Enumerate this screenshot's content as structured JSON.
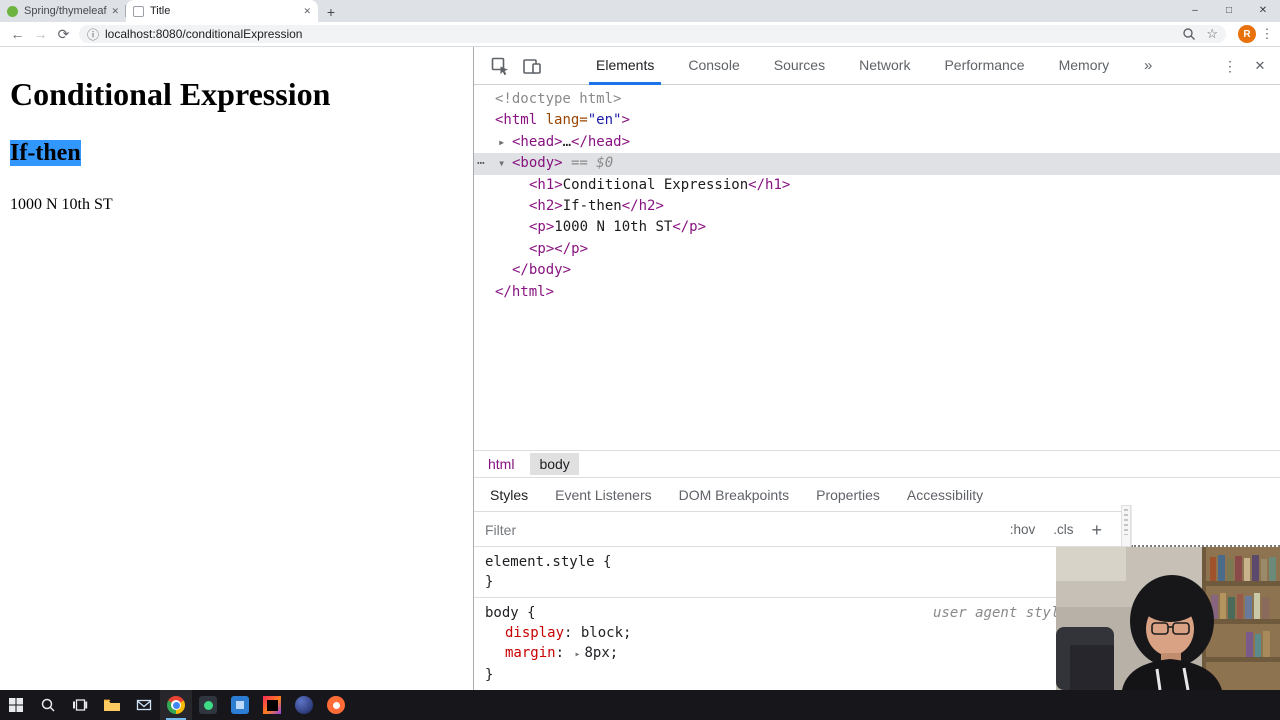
{
  "browser": {
    "tabs": [
      {
        "label": "Spring/thymeleafexpressionsynt",
        "active": false
      },
      {
        "label": "Title",
        "active": true
      }
    ],
    "url": "localhost:8080/conditionalExpression",
    "profile_initial": "R"
  },
  "icons": {
    "back": "←",
    "forward": "→",
    "reload": "⟳",
    "page_info": "ⓘ",
    "bookmark_star": "☆",
    "kebab_menu": "⋮",
    "window_minimize": "–",
    "window_maximize": "□",
    "window_close": "✕",
    "tab_close": "✕",
    "new_tab": "+",
    "devtools_overflow": "»",
    "devtools_close": "✕",
    "expand": "▸",
    "collapse": "▾",
    "more": "⋯"
  },
  "page": {
    "heading": "Conditional Expression",
    "subheading": "If-then",
    "paragraph": "1000 N 10th ST"
  },
  "devtools": {
    "tabs": [
      "Elements",
      "Console",
      "Sources",
      "Network",
      "Performance",
      "Memory"
    ],
    "active_tab": "Elements",
    "dom_tree": [
      {
        "name": "doctype",
        "indent": 0,
        "tokens": [
          {
            "t": "grey",
            "v": "<!doctype html>"
          }
        ]
      },
      {
        "name": "html-open",
        "indent": 0,
        "tokens": [
          {
            "t": "tag",
            "v": "<html"
          },
          {
            "t": "attr",
            "v": " lang="
          },
          {
            "t": "val",
            "v": "\"en\""
          },
          {
            "t": "tag",
            "v": ">"
          }
        ]
      },
      {
        "name": "head",
        "indent": 1,
        "arrow": "collapsed",
        "tokens": [
          {
            "t": "tag",
            "v": "<head>"
          },
          {
            "t": "text",
            "v": "…"
          },
          {
            "t": "tag",
            "v": "</head>"
          }
        ]
      },
      {
        "name": "body",
        "indent": 1,
        "arrow": "expanded",
        "selected": true,
        "ellipsis": true,
        "tokens": [
          {
            "t": "tag",
            "v": "<body>"
          },
          {
            "t": "grey",
            "v": " == "
          },
          {
            "t": "ital",
            "v": "$0"
          }
        ]
      },
      {
        "name": "h1",
        "indent": 2,
        "tokens": [
          {
            "t": "tag",
            "v": "<h1>"
          },
          {
            "t": "text",
            "v": "Conditional Expression"
          },
          {
            "t": "tag",
            "v": "</h1>"
          }
        ]
      },
      {
        "name": "h2",
        "indent": 2,
        "tokens": [
          {
            "t": "tag",
            "v": "<h2>"
          },
          {
            "t": "text",
            "v": "If-then"
          },
          {
            "t": "tag",
            "v": "</h2>"
          }
        ]
      },
      {
        "name": "p",
        "indent": 2,
        "tokens": [
          {
            "t": "tag",
            "v": "<p>"
          },
          {
            "t": "text",
            "v": "1000 N 10th ST"
          },
          {
            "t": "tag",
            "v": "</p>"
          }
        ]
      },
      {
        "name": "p-empty",
        "indent": 2,
        "tokens": [
          {
            "t": "tag",
            "v": "<p>"
          },
          {
            "t": "tag",
            "v": "</p>"
          }
        ]
      },
      {
        "name": "body-close",
        "indent": 1,
        "tokens": [
          {
            "t": "tag",
            "v": "</body>"
          }
        ]
      },
      {
        "name": "html-close",
        "indent": 0,
        "tokens": [
          {
            "t": "tag",
            "v": "</html>"
          }
        ]
      }
    ],
    "breadcrumbs": [
      {
        "label": "html",
        "selected": false
      },
      {
        "label": "body",
        "selected": true
      }
    ],
    "sidebar_tabs": [
      "Styles",
      "Event Listeners",
      "DOM Breakpoints",
      "Properties",
      "Accessibility"
    ],
    "active_sidebar_tab": "Styles",
    "filter_placeholder": "Filter",
    "pseudo_toggle": ":hov",
    "class_toggle": ".cls",
    "style_rules": [
      {
        "selector": "element.style",
        "origin": "",
        "properties": []
      },
      {
        "selector": "body",
        "origin": "user agent stylesheet",
        "properties": [
          {
            "name": "display",
            "value": "block",
            "expandable": false
          },
          {
            "name": "margin",
            "value": "8px",
            "expandable": true
          }
        ]
      }
    ]
  },
  "taskbar": {
    "icons": [
      "start",
      "search",
      "task-view",
      "file-explorer",
      "mail",
      "chrome",
      "green-app",
      "blue-app",
      "intellij",
      "eclipse",
      "orange-app"
    ],
    "active_icon": "chrome"
  }
}
